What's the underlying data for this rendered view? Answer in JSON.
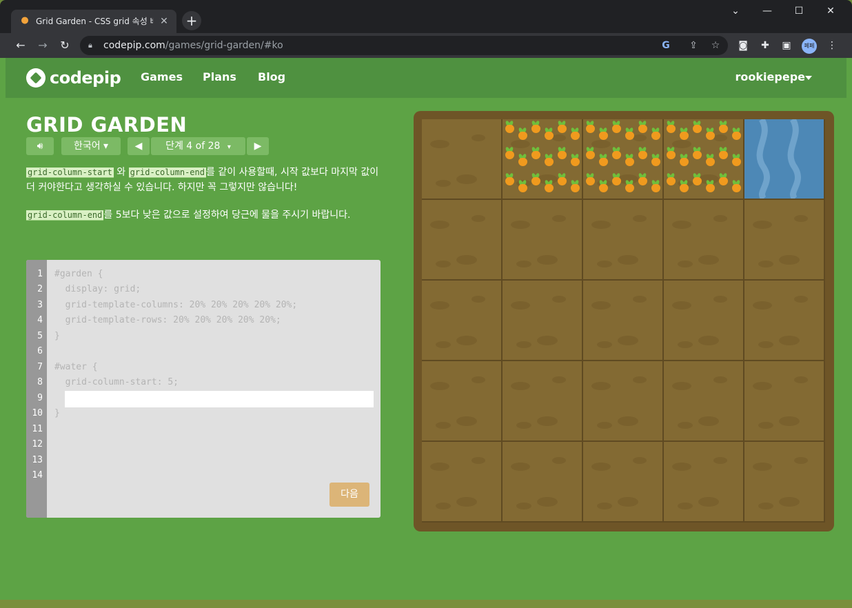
{
  "browser": {
    "tab_title": "Grid Garden - CSS grid 속성 배우기",
    "tab_close": "✕",
    "new_tab": "+",
    "url_domain": "codepip.com",
    "url_path": "/games/grid-garden/#ko",
    "profile_initials": "페페"
  },
  "site": {
    "logo_text": "codepip",
    "nav": [
      "Games",
      "Plans",
      "Blog"
    ],
    "username": "rookiepepe"
  },
  "game": {
    "title": "GRID GARDEN",
    "language": "한국어 ▾",
    "level": "단계 4 of 28",
    "level_caret": "▾",
    "instructions": {
      "p1_code1": "grid-column-start",
      "p1_mid": " 와 ",
      "p1_code2": "grid-column-end",
      "p1_text": "를 같이 사용할때, 시작 값보다 마지막 값이 더 커야한다고 생각하실 수 있습니다. 하지만 꼭 그렇지만 않습니다!",
      "p2_code": "grid-column-end",
      "p2_text": "를 5보다 낮은 값으로 설정하여 당근에 물을 주시기 바랍니다."
    },
    "editor": {
      "line_numbers": [
        "1",
        "2",
        "3",
        "4",
        "5",
        "6",
        "7",
        "8",
        "9",
        "10",
        "11",
        "12",
        "13",
        "14"
      ],
      "lines": [
        "#garden {",
        "  display: grid;",
        "  grid-template-columns: 20% 20% 20% 20% 20%;",
        "  grid-template-rows: 20% 20% 20% 20% 20%;",
        "}",
        "",
        "#water {",
        "  grid-column-start: 5;",
        "",
        "}"
      ],
      "answer_value": "",
      "next_button": "다음"
    },
    "garden": {
      "columns": 5,
      "rows": 5,
      "carrot_cells": [
        [
          0,
          1
        ],
        [
          0,
          2
        ],
        [
          0,
          3
        ]
      ],
      "water_cells": [
        [
          0,
          4
        ]
      ],
      "colors": {
        "dirt": "#836a33",
        "water": "#4d88b6",
        "frame": "#6e5527",
        "background": "#5da345"
      }
    }
  }
}
